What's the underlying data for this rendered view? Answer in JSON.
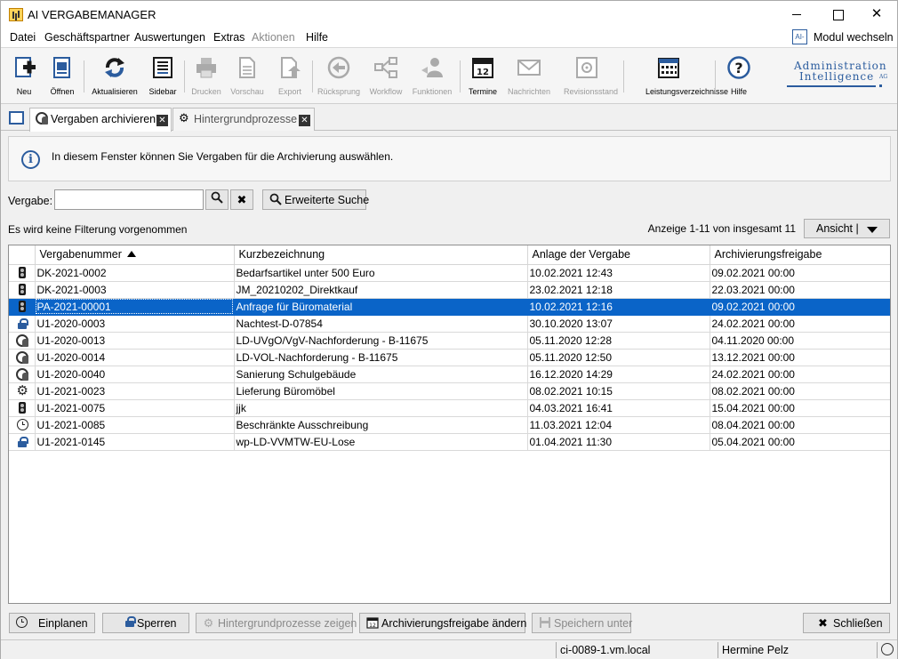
{
  "window": {
    "title": "AI VERGABEMANAGER"
  },
  "menu": {
    "items": [
      {
        "label": "Datei",
        "disabled": false
      },
      {
        "label": "Geschäftspartner",
        "disabled": false
      },
      {
        "label": "Auswertungen",
        "disabled": false
      },
      {
        "label": "Extras",
        "disabled": false
      },
      {
        "label": "Aktionen",
        "disabled": true
      },
      {
        "label": "Hilfe",
        "disabled": false
      }
    ],
    "modul_wechseln": "Modul wechseln",
    "modul_icon_text": "AI-"
  },
  "toolbar": {
    "buttons": [
      {
        "label": "Neu",
        "icon": "new-document-icon",
        "disabled": false
      },
      {
        "label": "Öffnen",
        "icon": "open-document-icon",
        "disabled": false
      },
      {
        "label": "Aktualisieren",
        "icon": "refresh-icon",
        "disabled": false
      },
      {
        "label": "Sidebar",
        "icon": "sidebar-icon",
        "disabled": false
      },
      {
        "label": "Drucken",
        "icon": "printer-icon",
        "disabled": true
      },
      {
        "label": "Vorschau",
        "icon": "preview-icon",
        "disabled": true
      },
      {
        "label": "Export",
        "icon": "export-icon",
        "disabled": true
      },
      {
        "label": "Rücksprung",
        "icon": "back-icon",
        "disabled": true
      },
      {
        "label": "Workflow",
        "icon": "workflow-icon",
        "disabled": true
      },
      {
        "label": "Funktionen",
        "icon": "functions-icon",
        "disabled": true
      },
      {
        "label": "Termine",
        "icon": "calendar-icon",
        "disabled": false
      },
      {
        "label": "Nachrichten",
        "icon": "envelope-icon",
        "disabled": true
      },
      {
        "label": "Revisionsstand",
        "icon": "safe-icon",
        "disabled": true
      },
      {
        "label": "Leistungsverzeichnisse",
        "icon": "grid-calendar-icon",
        "disabled": false
      },
      {
        "label": "Hilfe",
        "icon": "help-icon",
        "disabled": false
      }
    ],
    "logo": {
      "line1": "Administration",
      "line2": "Intelligence",
      "suffix": "AG"
    }
  },
  "tabs": [
    {
      "label": "Vergaben archivieren",
      "icon": "archive-icon",
      "active": true
    },
    {
      "label": "Hintergrundprozesse",
      "icon": "gear-icon",
      "active": false
    }
  ],
  "info": {
    "text": "In diesem Fenster können Sie Vergaben für die Archivierung auswählen."
  },
  "search": {
    "label": "Vergabe:",
    "value": "",
    "advanced_label": "Erweiterte Suche"
  },
  "filter_status": "Es wird keine Filterung vorgenommen",
  "pager": {
    "text": "Anzeige 1-11 von insgesamt 11",
    "view_label": "Ansicht |"
  },
  "table": {
    "columns": [
      "",
      "Vergabenummer",
      "Kurzbezeichnung",
      "Anlage der Vergabe",
      "Archivierungsfreigabe"
    ],
    "rows": [
      {
        "status_icon": "traffic-light-icon",
        "nummer": "DK-2021-0002",
        "kurz": "Bedarfsartikel unter 500 Euro",
        "anlage": "10.02.2021 12:43",
        "freigabe": "09.02.2021 00:00",
        "selected": false
      },
      {
        "status_icon": "traffic-light-icon",
        "nummer": "DK-2021-0003",
        "kurz": "JM_20210202_Direktkauf",
        "anlage": "23.02.2021 12:18",
        "freigabe": "22.03.2021 00:00",
        "selected": false
      },
      {
        "status_icon": "traffic-light-icon",
        "nummer": "PA-2021-00001",
        "kurz": "Anfrage für Büromaterial",
        "anlage": "10.02.2021 12:16",
        "freigabe": "09.02.2021 00:00",
        "selected": true
      },
      {
        "status_icon": "lock-icon",
        "nummer": "U1-2020-0003",
        "kurz": "Nachtest-D-07854",
        "anlage": "30.10.2020 13:07",
        "freigabe": "24.02.2021 00:00",
        "selected": false
      },
      {
        "status_icon": "archive-icon",
        "nummer": "U1-2020-0013",
        "kurz": "LD-UVgO/VgV-Nachforderung - B-11675",
        "anlage": "05.11.2020 12:28",
        "freigabe": "04.11.2020 00:00",
        "selected": false
      },
      {
        "status_icon": "archive-icon",
        "nummer": "U1-2020-0014",
        "kurz": "LD-VOL-Nachforderung - B-11675",
        "anlage": "05.11.2020 12:50",
        "freigabe": "13.12.2021 00:00",
        "selected": false
      },
      {
        "status_icon": "archive-icon",
        "nummer": "U1-2020-0040",
        "kurz": "Sanierung Schulgebäude",
        "anlage": "16.12.2020 14:29",
        "freigabe": "24.02.2021 00:00",
        "selected": false
      },
      {
        "status_icon": "gear-icon",
        "nummer": "U1-2021-0023",
        "kurz": "Lieferung Büromöbel",
        "anlage": "08.02.2021 10:15",
        "freigabe": "08.02.2021 00:00",
        "selected": false
      },
      {
        "status_icon": "traffic-light-icon",
        "nummer": "U1-2021-0075",
        "kurz": "jjk",
        "anlage": "04.03.2021 16:41",
        "freigabe": "15.04.2021 00:00",
        "selected": false
      },
      {
        "status_icon": "clock-icon",
        "nummer": "U1-2021-0085",
        "kurz": "Beschränkte Ausschreibung",
        "anlage": "11.03.2021 12:04",
        "freigabe": "08.04.2021 00:00",
        "selected": false
      },
      {
        "status_icon": "lock-icon",
        "nummer": "U1-2021-0145",
        "kurz": "wp-LD-VVMTW-EU-Lose",
        "anlage": "01.04.2021 11:30",
        "freigabe": "05.04.2021 00:00",
        "selected": false
      }
    ]
  },
  "bottom_buttons": [
    {
      "label": "Einplanen",
      "icon": "clock-icon",
      "disabled": false
    },
    {
      "label": "Sperren",
      "icon": "lock-icon",
      "disabled": false
    },
    {
      "label": "Hintergrundprozesse zeigen",
      "icon": "gear-icon",
      "disabled": true
    },
    {
      "label": "Archivierungsfreigabe ändern",
      "icon": "calendar-icon",
      "disabled": false
    },
    {
      "label": "Speichern unter",
      "icon": "save-icon",
      "disabled": true
    },
    {
      "label": "Schließen",
      "icon": "close-icon",
      "disabled": false
    }
  ],
  "statusbar": {
    "host": "ci-0089-1.vm.local",
    "user": "Hermine Pelz"
  },
  "colors": {
    "selection": "#0a64c8",
    "accent": "#2b5c9e"
  }
}
